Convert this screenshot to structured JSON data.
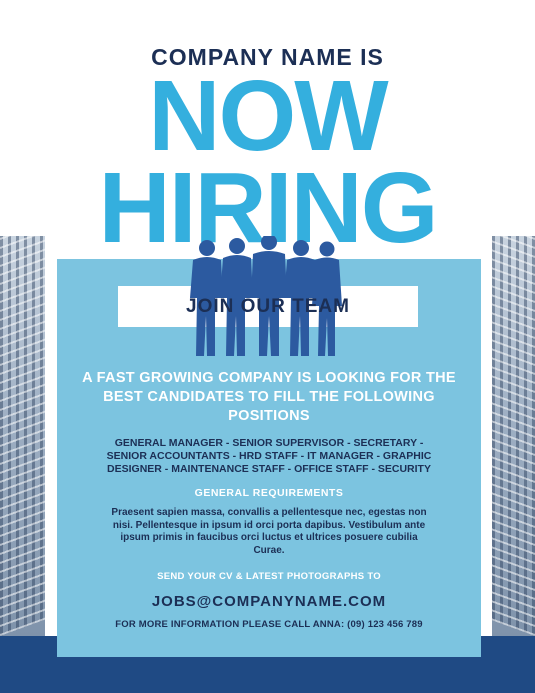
{
  "header": {
    "company_line": "COMPANY NAME IS",
    "headline_top": "NOW",
    "headline_bottom": "HIRING"
  },
  "banner": {
    "join_label": "JOIN OUR TEAM"
  },
  "intro": {
    "text": "A FAST GROWING COMPANY IS LOOKING FOR THE BEST CANDIDATES TO FILL THE FOLLOWING POSITIONS"
  },
  "positions": {
    "text": "GENERAL MANAGER - SENIOR SUPERVISOR - SECRETARY - SENIOR ACCOUNTANTS - HRD STAFF - IT MANAGER - GRAPHIC DESIGNER - MAINTENANCE STAFF - OFFICE STAFF - SECURITY"
  },
  "requirements": {
    "title": "GENERAL REQUIREMENTS",
    "body": "Praesent sapien massa, convallis a pellentesque nec, egestas non nisi. Pellentesque in ipsum id orci porta dapibus. Vestibulum ante ipsum primis in faucibus orci luctus et ultrices posuere cubilia Curae."
  },
  "contact": {
    "send_line": "SEND YOUR CV & LATEST PHOTOGRAPHS TO",
    "email": "JOBS@COMPANYNAME.COM",
    "call_line": "FOR MORE INFORMATION PLEASE CALL ANNA: (09) 123 456 789"
  },
  "icons": {
    "people": "team-silhouette-icon"
  },
  "colors": {
    "accent": "#34afde",
    "panel": "#7cc4e0",
    "navy": "#1c2f55",
    "band": "#1f4a84"
  }
}
